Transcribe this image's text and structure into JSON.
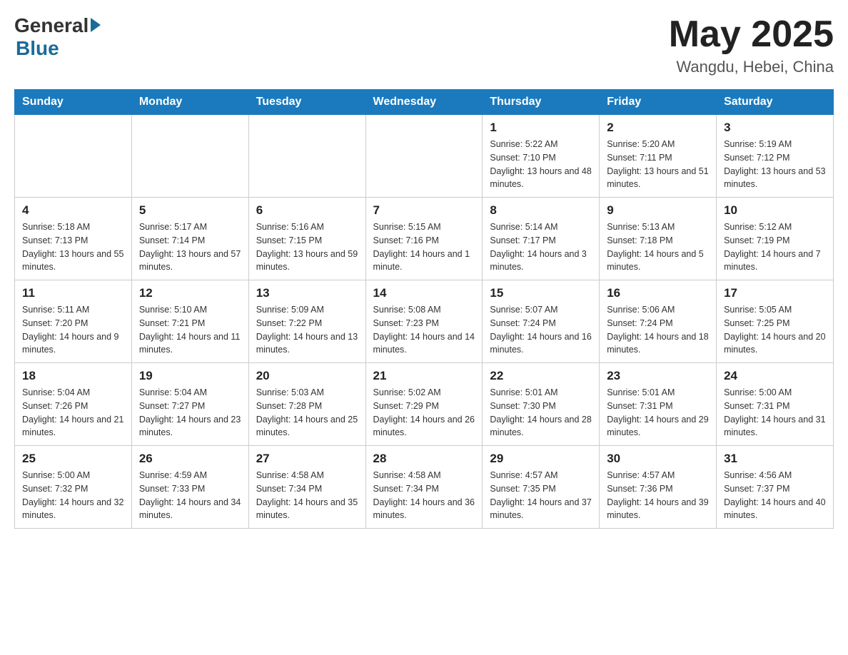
{
  "header": {
    "logo_general": "General",
    "logo_blue": "Blue",
    "month_title": "May 2025",
    "location": "Wangdu, Hebei, China"
  },
  "days_of_week": [
    "Sunday",
    "Monday",
    "Tuesday",
    "Wednesday",
    "Thursday",
    "Friday",
    "Saturday"
  ],
  "weeks": [
    [
      {
        "day": "",
        "info": ""
      },
      {
        "day": "",
        "info": ""
      },
      {
        "day": "",
        "info": ""
      },
      {
        "day": "",
        "info": ""
      },
      {
        "day": "1",
        "info": "Sunrise: 5:22 AM\nSunset: 7:10 PM\nDaylight: 13 hours and 48 minutes."
      },
      {
        "day": "2",
        "info": "Sunrise: 5:20 AM\nSunset: 7:11 PM\nDaylight: 13 hours and 51 minutes."
      },
      {
        "day": "3",
        "info": "Sunrise: 5:19 AM\nSunset: 7:12 PM\nDaylight: 13 hours and 53 minutes."
      }
    ],
    [
      {
        "day": "4",
        "info": "Sunrise: 5:18 AM\nSunset: 7:13 PM\nDaylight: 13 hours and 55 minutes."
      },
      {
        "day": "5",
        "info": "Sunrise: 5:17 AM\nSunset: 7:14 PM\nDaylight: 13 hours and 57 minutes."
      },
      {
        "day": "6",
        "info": "Sunrise: 5:16 AM\nSunset: 7:15 PM\nDaylight: 13 hours and 59 minutes."
      },
      {
        "day": "7",
        "info": "Sunrise: 5:15 AM\nSunset: 7:16 PM\nDaylight: 14 hours and 1 minute."
      },
      {
        "day": "8",
        "info": "Sunrise: 5:14 AM\nSunset: 7:17 PM\nDaylight: 14 hours and 3 minutes."
      },
      {
        "day": "9",
        "info": "Sunrise: 5:13 AM\nSunset: 7:18 PM\nDaylight: 14 hours and 5 minutes."
      },
      {
        "day": "10",
        "info": "Sunrise: 5:12 AM\nSunset: 7:19 PM\nDaylight: 14 hours and 7 minutes."
      }
    ],
    [
      {
        "day": "11",
        "info": "Sunrise: 5:11 AM\nSunset: 7:20 PM\nDaylight: 14 hours and 9 minutes."
      },
      {
        "day": "12",
        "info": "Sunrise: 5:10 AM\nSunset: 7:21 PM\nDaylight: 14 hours and 11 minutes."
      },
      {
        "day": "13",
        "info": "Sunrise: 5:09 AM\nSunset: 7:22 PM\nDaylight: 14 hours and 13 minutes."
      },
      {
        "day": "14",
        "info": "Sunrise: 5:08 AM\nSunset: 7:23 PM\nDaylight: 14 hours and 14 minutes."
      },
      {
        "day": "15",
        "info": "Sunrise: 5:07 AM\nSunset: 7:24 PM\nDaylight: 14 hours and 16 minutes."
      },
      {
        "day": "16",
        "info": "Sunrise: 5:06 AM\nSunset: 7:24 PM\nDaylight: 14 hours and 18 minutes."
      },
      {
        "day": "17",
        "info": "Sunrise: 5:05 AM\nSunset: 7:25 PM\nDaylight: 14 hours and 20 minutes."
      }
    ],
    [
      {
        "day": "18",
        "info": "Sunrise: 5:04 AM\nSunset: 7:26 PM\nDaylight: 14 hours and 21 minutes."
      },
      {
        "day": "19",
        "info": "Sunrise: 5:04 AM\nSunset: 7:27 PM\nDaylight: 14 hours and 23 minutes."
      },
      {
        "day": "20",
        "info": "Sunrise: 5:03 AM\nSunset: 7:28 PM\nDaylight: 14 hours and 25 minutes."
      },
      {
        "day": "21",
        "info": "Sunrise: 5:02 AM\nSunset: 7:29 PM\nDaylight: 14 hours and 26 minutes."
      },
      {
        "day": "22",
        "info": "Sunrise: 5:01 AM\nSunset: 7:30 PM\nDaylight: 14 hours and 28 minutes."
      },
      {
        "day": "23",
        "info": "Sunrise: 5:01 AM\nSunset: 7:31 PM\nDaylight: 14 hours and 29 minutes."
      },
      {
        "day": "24",
        "info": "Sunrise: 5:00 AM\nSunset: 7:31 PM\nDaylight: 14 hours and 31 minutes."
      }
    ],
    [
      {
        "day": "25",
        "info": "Sunrise: 5:00 AM\nSunset: 7:32 PM\nDaylight: 14 hours and 32 minutes."
      },
      {
        "day": "26",
        "info": "Sunrise: 4:59 AM\nSunset: 7:33 PM\nDaylight: 14 hours and 34 minutes."
      },
      {
        "day": "27",
        "info": "Sunrise: 4:58 AM\nSunset: 7:34 PM\nDaylight: 14 hours and 35 minutes."
      },
      {
        "day": "28",
        "info": "Sunrise: 4:58 AM\nSunset: 7:34 PM\nDaylight: 14 hours and 36 minutes."
      },
      {
        "day": "29",
        "info": "Sunrise: 4:57 AM\nSunset: 7:35 PM\nDaylight: 14 hours and 37 minutes."
      },
      {
        "day": "30",
        "info": "Sunrise: 4:57 AM\nSunset: 7:36 PM\nDaylight: 14 hours and 39 minutes."
      },
      {
        "day": "31",
        "info": "Sunrise: 4:56 AM\nSunset: 7:37 PM\nDaylight: 14 hours and 40 minutes."
      }
    ]
  ]
}
